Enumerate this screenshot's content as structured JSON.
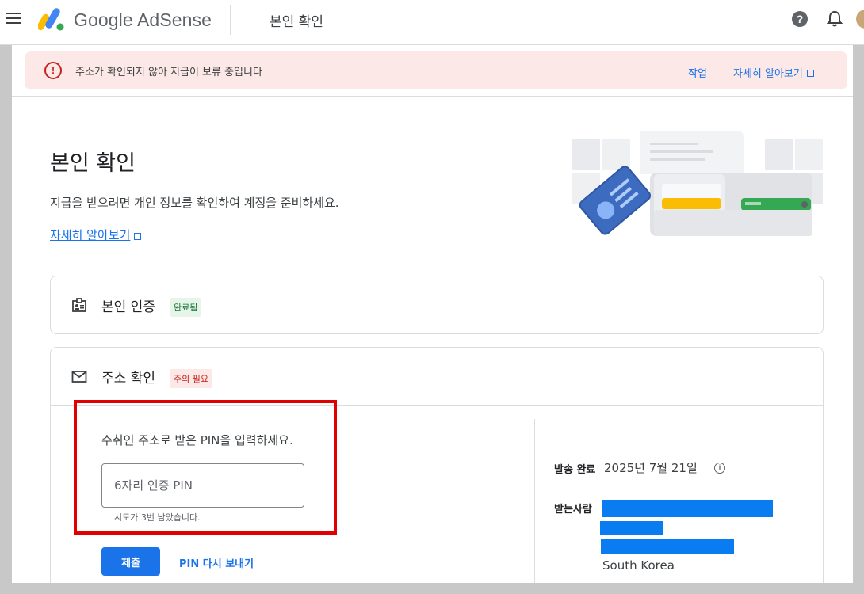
{
  "header": {
    "brand": "Google AdSense",
    "title": "본인 확인"
  },
  "alert": {
    "message": "주소가 확인되지 않아 지급이 보류 중입니다",
    "action_label": "작업",
    "learn_more_label": "자세히 알아보기"
  },
  "main": {
    "title": "본인 확인",
    "description": "지급을 받으려면 개인 정보를 확인하여 계정을 준비하세요.",
    "learn_more_label": "자세히 알아보기"
  },
  "identity_card": {
    "title": "본인 인증",
    "status": "완료됨"
  },
  "address_card": {
    "title": "주소 확인",
    "status": "주의 필요",
    "instruction": "수취인 주소로 받은 PIN을 입력하세요.",
    "pin_placeholder": "6자리 인증 PIN",
    "pin_value": "",
    "attempts": "시도가 3번 남았습니다.",
    "submit_label": "제출",
    "resend_label": "PIN 다시 보내기",
    "sent_label": "발송 완료",
    "sent_date": "2025년 7월 21일",
    "recipient_label": "받는사람",
    "country": "South Korea"
  },
  "colors": {
    "accent": "#1a73e8",
    "alert_bg": "#fce8e6",
    "error": "#c5221f",
    "success": "#137333",
    "redaction": "#0a7cf2",
    "highlight": "#e00000"
  },
  "icons": {
    "menu": "menu-icon",
    "help": "help-icon",
    "notifications": "bell-icon",
    "alert": "error-icon",
    "external_link": "external-link-icon",
    "identity": "id-badge-icon",
    "address": "mail-icon",
    "info": "info-icon"
  }
}
